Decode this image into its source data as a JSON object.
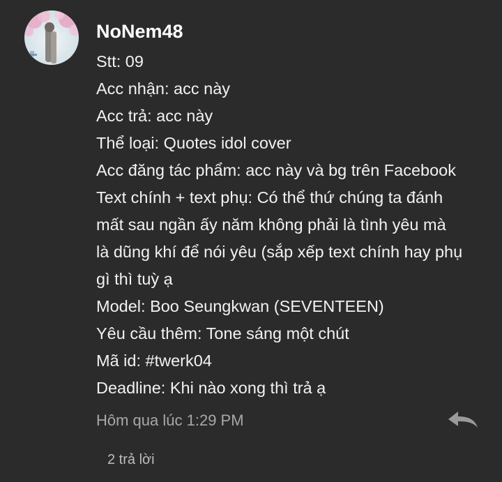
{
  "comment": {
    "author": "NoNem48",
    "lines": [
      "Stt: 09",
      "Acc nhận: acc này",
      "Acc trả: acc này",
      "Thể loại: Quotes idol cover",
      "Acc đăng tác phẩm: acc này và bg trên Facebook",
      "Text chính + text phụ: Có thể thứ chúng ta đánh",
      "mất sau ngần ấy năm không phải là tình yêu mà",
      "là dũng khí để nói yêu (sắp xếp text chính hay phụ",
      "gì thì tuỳ ạ",
      "Model: Boo Seungkwan (SEVENTEEN)",
      "Yêu cầu thêm: Tone sáng một chút",
      "Mã id: #twerk04",
      "Deadline: Khi nào xong thì trả ạ"
    ],
    "timestamp": "Hôm qua lúc 1:29 PM",
    "reply_icon": "reply-arrow-icon",
    "replies_label": "2 trả lời"
  },
  "colors": {
    "background": "#2b2b2b",
    "text": "#f2f2f2",
    "meta": "#a8a8a8",
    "icon": "#9a9a9a"
  }
}
